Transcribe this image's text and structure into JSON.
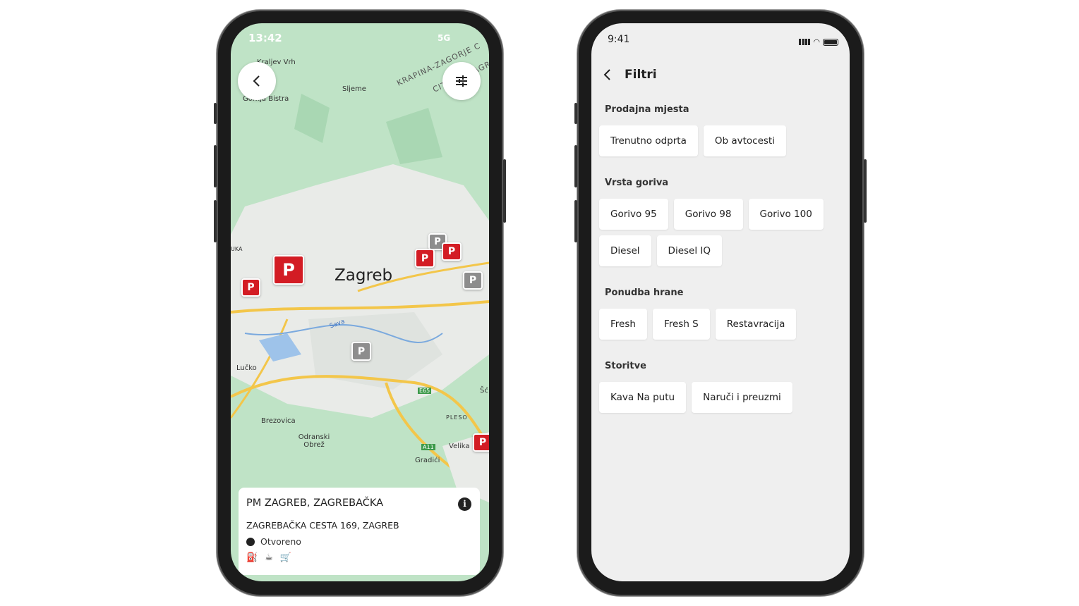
{
  "map_screen": {
    "time": "13:42",
    "network": "5G",
    "labels": [
      "Kraljev Vrh",
      "Gornja Bistra",
      "Sljeme",
      "KRAPINA-ZAGORJE C",
      "CITY OF ZAGREB",
      "Zagreb",
      "Sava",
      "Lučko",
      "Brezovica",
      "Odranski Obrež",
      "Velika",
      "Gradići",
      "PLESO",
      "E65",
      "A11",
      "UKA",
      "Šć"
    ],
    "pin_letter": "P",
    "card": {
      "title": "PM ZAGREB, ZAGREBAČKA",
      "address": "ZAGREBAČKA CESTA 169, ZAGREB",
      "status": "Otvoreno",
      "amenities": [
        "fuel-icon",
        "coffee-cup-icon",
        "cart-icon"
      ]
    }
  },
  "filters_screen": {
    "time": "9:41",
    "title": "Filtri",
    "sections": [
      {
        "label": "Prodajna mjesta",
        "options": [
          "Trenutno odprta",
          "Ob avtocesti"
        ]
      },
      {
        "label": "Vrsta goriva",
        "options": [
          "Gorivo 95",
          "Gorivo 98",
          "Gorivo 100",
          "Diesel",
          "Diesel IQ"
        ]
      },
      {
        "label": "Ponudba hrane",
        "options": [
          "Fresh",
          "Fresh S",
          "Restavracija"
        ]
      },
      {
        "label": "Storitve",
        "options": [
          "Kava Na putu",
          "Naruči i preuzmi"
        ]
      }
    ]
  },
  "colors": {
    "brand_red": "#d31c24",
    "map_green": "#bfe3c6",
    "road_yellow": "#f3c64a",
    "filter_bg": "#efefef"
  }
}
